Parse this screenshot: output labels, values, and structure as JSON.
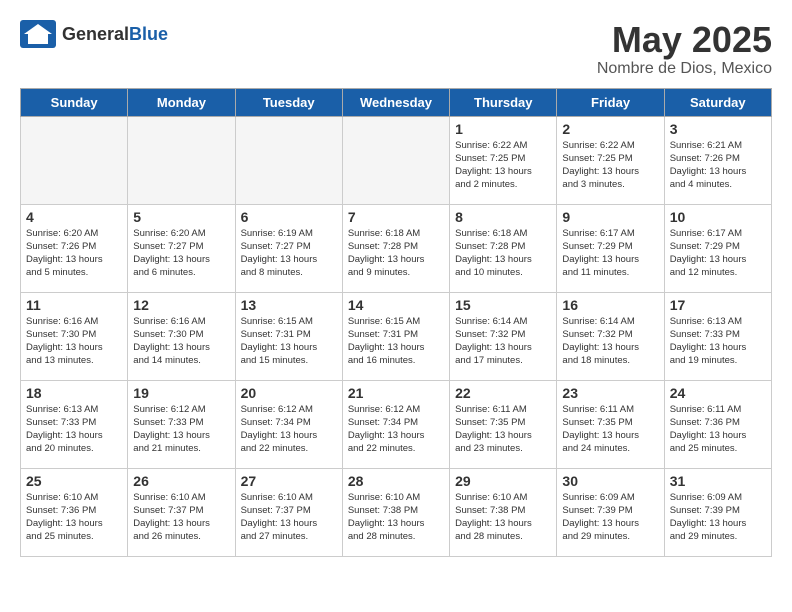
{
  "header": {
    "logo_general": "General",
    "logo_blue": "Blue",
    "month_year": "May 2025",
    "location": "Nombre de Dios, Mexico"
  },
  "days_of_week": [
    "Sunday",
    "Monday",
    "Tuesday",
    "Wednesday",
    "Thursday",
    "Friday",
    "Saturday"
  ],
  "weeks": [
    [
      {
        "day": "",
        "info": "",
        "empty": true
      },
      {
        "day": "",
        "info": "",
        "empty": true
      },
      {
        "day": "",
        "info": "",
        "empty": true
      },
      {
        "day": "",
        "info": "",
        "empty": true
      },
      {
        "day": "1",
        "info": "Sunrise: 6:22 AM\nSunset: 7:25 PM\nDaylight: 13 hours\nand 2 minutes."
      },
      {
        "day": "2",
        "info": "Sunrise: 6:22 AM\nSunset: 7:25 PM\nDaylight: 13 hours\nand 3 minutes."
      },
      {
        "day": "3",
        "info": "Sunrise: 6:21 AM\nSunset: 7:26 PM\nDaylight: 13 hours\nand 4 minutes."
      }
    ],
    [
      {
        "day": "4",
        "info": "Sunrise: 6:20 AM\nSunset: 7:26 PM\nDaylight: 13 hours\nand 5 minutes."
      },
      {
        "day": "5",
        "info": "Sunrise: 6:20 AM\nSunset: 7:27 PM\nDaylight: 13 hours\nand 6 minutes."
      },
      {
        "day": "6",
        "info": "Sunrise: 6:19 AM\nSunset: 7:27 PM\nDaylight: 13 hours\nand 8 minutes."
      },
      {
        "day": "7",
        "info": "Sunrise: 6:18 AM\nSunset: 7:28 PM\nDaylight: 13 hours\nand 9 minutes."
      },
      {
        "day": "8",
        "info": "Sunrise: 6:18 AM\nSunset: 7:28 PM\nDaylight: 13 hours\nand 10 minutes."
      },
      {
        "day": "9",
        "info": "Sunrise: 6:17 AM\nSunset: 7:29 PM\nDaylight: 13 hours\nand 11 minutes."
      },
      {
        "day": "10",
        "info": "Sunrise: 6:17 AM\nSunset: 7:29 PM\nDaylight: 13 hours\nand 12 minutes."
      }
    ],
    [
      {
        "day": "11",
        "info": "Sunrise: 6:16 AM\nSunset: 7:30 PM\nDaylight: 13 hours\nand 13 minutes."
      },
      {
        "day": "12",
        "info": "Sunrise: 6:16 AM\nSunset: 7:30 PM\nDaylight: 13 hours\nand 14 minutes."
      },
      {
        "day": "13",
        "info": "Sunrise: 6:15 AM\nSunset: 7:31 PM\nDaylight: 13 hours\nand 15 minutes."
      },
      {
        "day": "14",
        "info": "Sunrise: 6:15 AM\nSunset: 7:31 PM\nDaylight: 13 hours\nand 16 minutes."
      },
      {
        "day": "15",
        "info": "Sunrise: 6:14 AM\nSunset: 7:32 PM\nDaylight: 13 hours\nand 17 minutes."
      },
      {
        "day": "16",
        "info": "Sunrise: 6:14 AM\nSunset: 7:32 PM\nDaylight: 13 hours\nand 18 minutes."
      },
      {
        "day": "17",
        "info": "Sunrise: 6:13 AM\nSunset: 7:33 PM\nDaylight: 13 hours\nand 19 minutes."
      }
    ],
    [
      {
        "day": "18",
        "info": "Sunrise: 6:13 AM\nSunset: 7:33 PM\nDaylight: 13 hours\nand 20 minutes."
      },
      {
        "day": "19",
        "info": "Sunrise: 6:12 AM\nSunset: 7:33 PM\nDaylight: 13 hours\nand 21 minutes."
      },
      {
        "day": "20",
        "info": "Sunrise: 6:12 AM\nSunset: 7:34 PM\nDaylight: 13 hours\nand 22 minutes."
      },
      {
        "day": "21",
        "info": "Sunrise: 6:12 AM\nSunset: 7:34 PM\nDaylight: 13 hours\nand 22 minutes."
      },
      {
        "day": "22",
        "info": "Sunrise: 6:11 AM\nSunset: 7:35 PM\nDaylight: 13 hours\nand 23 minutes."
      },
      {
        "day": "23",
        "info": "Sunrise: 6:11 AM\nSunset: 7:35 PM\nDaylight: 13 hours\nand 24 minutes."
      },
      {
        "day": "24",
        "info": "Sunrise: 6:11 AM\nSunset: 7:36 PM\nDaylight: 13 hours\nand 25 minutes."
      }
    ],
    [
      {
        "day": "25",
        "info": "Sunrise: 6:10 AM\nSunset: 7:36 PM\nDaylight: 13 hours\nand 25 minutes."
      },
      {
        "day": "26",
        "info": "Sunrise: 6:10 AM\nSunset: 7:37 PM\nDaylight: 13 hours\nand 26 minutes."
      },
      {
        "day": "27",
        "info": "Sunrise: 6:10 AM\nSunset: 7:37 PM\nDaylight: 13 hours\nand 27 minutes."
      },
      {
        "day": "28",
        "info": "Sunrise: 6:10 AM\nSunset: 7:38 PM\nDaylight: 13 hours\nand 28 minutes."
      },
      {
        "day": "29",
        "info": "Sunrise: 6:10 AM\nSunset: 7:38 PM\nDaylight: 13 hours\nand 28 minutes."
      },
      {
        "day": "30",
        "info": "Sunrise: 6:09 AM\nSunset: 7:39 PM\nDaylight: 13 hours\nand 29 minutes."
      },
      {
        "day": "31",
        "info": "Sunrise: 6:09 AM\nSunset: 7:39 PM\nDaylight: 13 hours\nand 29 minutes."
      }
    ]
  ]
}
